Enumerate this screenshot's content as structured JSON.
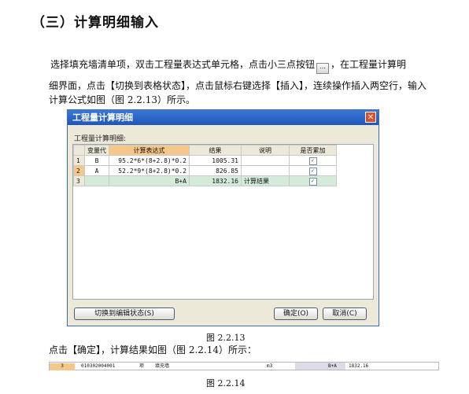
{
  "heading": "（三）计算明细输入",
  "paragraph": {
    "line1_before": "选择填充墙清单项，双击工程量表达式单元格，点击小三点按钮",
    "line1_button": "…",
    "line1_after": "，在工程量计算明",
    "line2": "细界面，点击【切换到表格状态】，点击鼠标右键选择【插入】，连续操作插入两空行，输入",
    "line3": "计算公式如图（图 2.2.13）所示。"
  },
  "dialog": {
    "title": "工程量计算明细",
    "close": "✕",
    "subtitle": "工程量计算明细:",
    "columns": [
      "",
      "变量代",
      "计算表达式",
      "结果",
      "说明",
      "是否累加"
    ],
    "rows": [
      {
        "num": "1",
        "code": "B",
        "expr": "95.2*6*(8+2.8)*0.2",
        "result": "1005.31",
        "note": "",
        "acc": "✓"
      },
      {
        "num": "2",
        "code": "A",
        "expr": "52.2*9*(8+2.8)*0.2",
        "result": "826.85",
        "note": "",
        "acc": "✓"
      },
      {
        "num": "3",
        "code": "",
        "expr": "B+A",
        "result": "1832.16",
        "note": "计算结果",
        "acc": "✓"
      }
    ],
    "buttons": {
      "switch": "切换到编辑状态(S)",
      "ok": "确定(O)",
      "cancel": "取消(C)"
    }
  },
  "caption1": "图 2.2.13",
  "instruction": "点击【确定】，计算结果如图（图 2.2.14）所示：",
  "result_row": {
    "num": "3",
    "code": "010302004001",
    "type": "项",
    "name": "填充墙",
    "unit": "m3",
    "expr": "B+A",
    "value": "1832.16"
  },
  "caption2": "图 2.2.14"
}
